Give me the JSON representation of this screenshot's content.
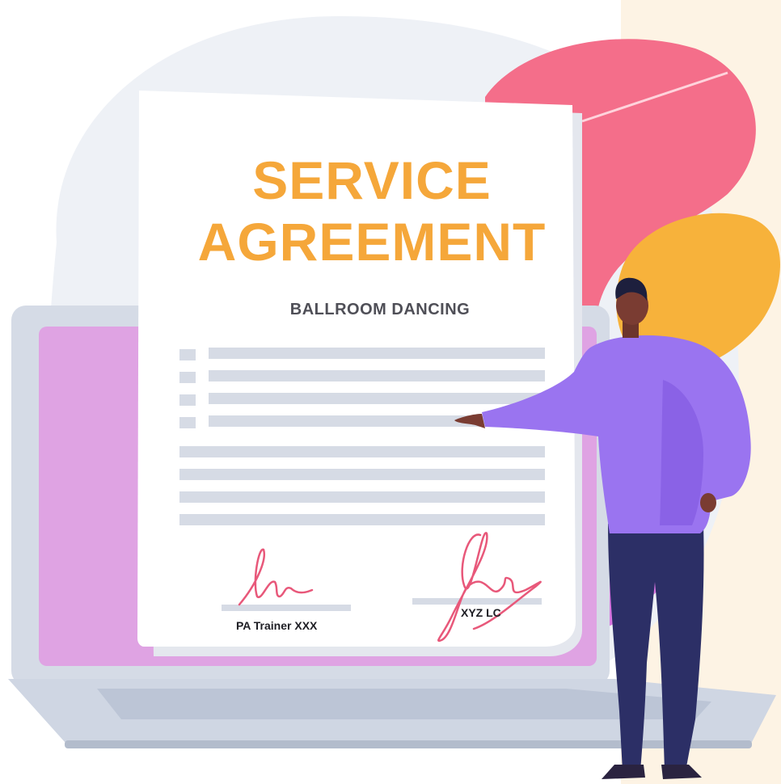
{
  "document": {
    "title_line_1": "SERVICE",
    "title_line_2": "AGREEMENT",
    "subtitle": "BALLROOM DANCING"
  },
  "signatures": {
    "left_name": "PA Trainer XXX",
    "right_name": "XYZ LC"
  },
  "colors": {
    "accent": "#f5a73a",
    "signature_ink": "#e8587a",
    "blob_pink": "#f46e8a",
    "blob_yellow": "#f7b23b",
    "shirt": "#9a74f0",
    "trousers": "#2c2f66",
    "laptop": "#c9d1df",
    "cream_panel": "#fdf3e4"
  },
  "icons": {
    "person": "man-presenting-illustration",
    "laptop": "laptop-illustration"
  }
}
